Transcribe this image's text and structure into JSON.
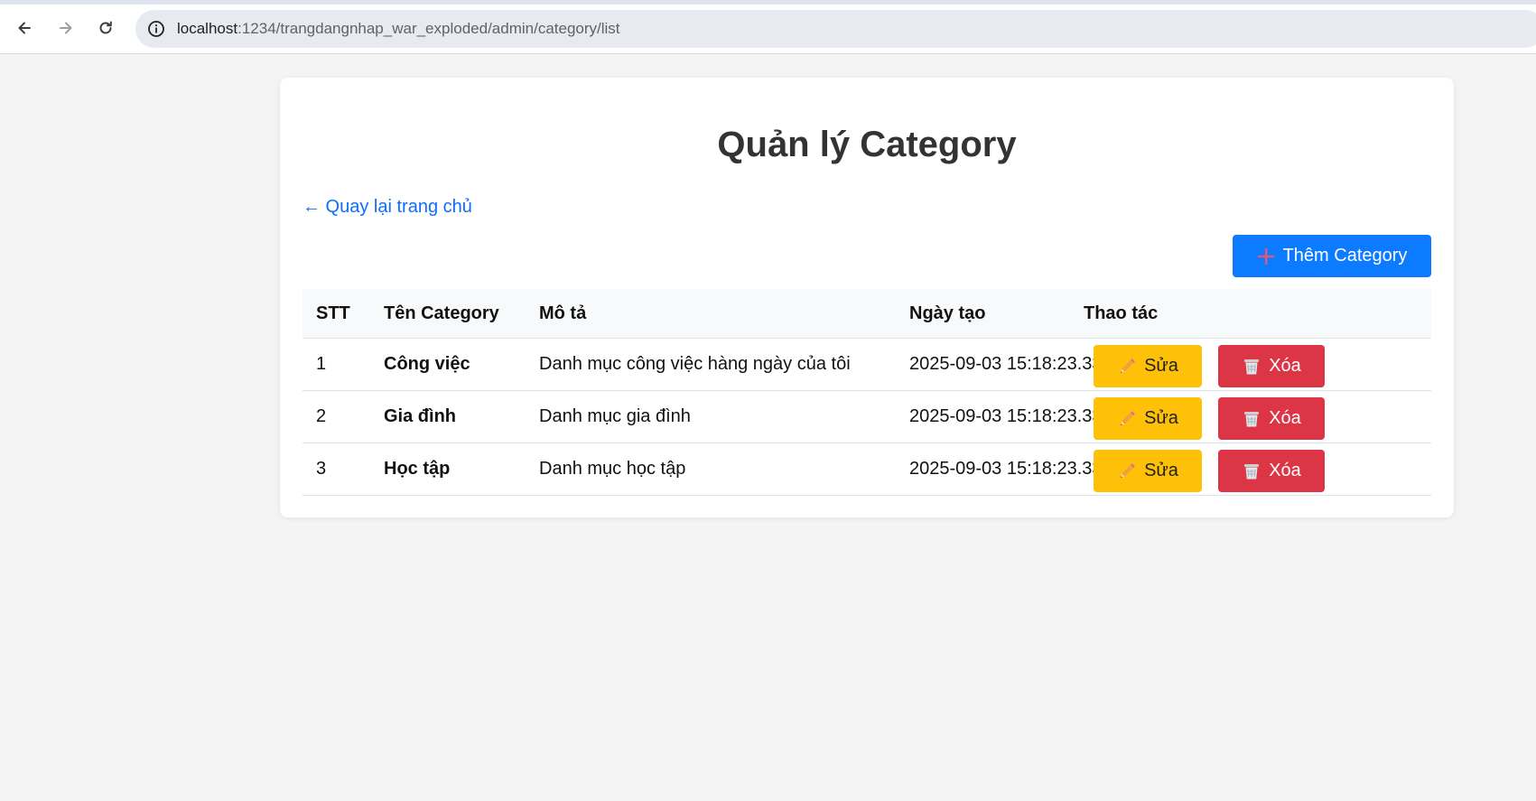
{
  "browser": {
    "url_host": "localhost",
    "url_path": ":1234/trangdangnhap_war_exploded/admin/category/list"
  },
  "page": {
    "title": "Quản lý Category",
    "back_link": "← Quay lại trang chủ",
    "add_button": "Thêm Category"
  },
  "table": {
    "headers": [
      "STT",
      "Tên Category",
      "Mô tả",
      "Ngày tạo",
      "Thao tác"
    ],
    "rows": [
      {
        "stt": "1",
        "name": "Công việc",
        "desc": "Danh mục công việc hàng ngày của tôi",
        "date": "2025-09-03 15:18:23.33",
        "edit": "Sửa",
        "delete": "Xóa"
      },
      {
        "stt": "2",
        "name": "Gia đình",
        "desc": "Danh mục gia đình",
        "date": "2025-09-03 15:18:23.33",
        "edit": "Sửa",
        "delete": "Xóa"
      },
      {
        "stt": "3",
        "name": "Học tập",
        "desc": "Danh mục học tập",
        "date": "2025-09-03 15:18:23.33",
        "edit": "Sửa",
        "delete": "Xóa"
      }
    ]
  },
  "colors": {
    "primary": "#0d7bff",
    "warning": "#ffc107",
    "danger": "#dc3545",
    "link": "#0d6efd"
  },
  "icons": {
    "back": "arrow-left-icon",
    "forward": "arrow-right-icon",
    "reload": "reload-icon",
    "site_info": "info-icon",
    "add": "plus-icon",
    "edit": "pencil-icon",
    "delete": "wastebasket-icon"
  }
}
